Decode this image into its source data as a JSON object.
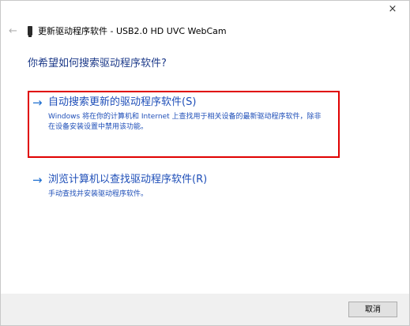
{
  "window": {
    "close_glyph": "×",
    "header": {
      "back_glyph": "←",
      "title": "更新驱动程序软件 - USB2.0 HD UVC WebCam"
    }
  },
  "question": "你希望如何搜索驱动程序软件?",
  "options": [
    {
      "arrow": "→",
      "title": "自动搜索更新的驱动程序软件(S)",
      "description": "Windows 将在你的计算机和 Internet 上查找用于相关设备的最新驱动程序软件，除非在设备安装设置中禁用该功能。"
    },
    {
      "arrow": "→",
      "title": "浏览计算机以查找驱动程序软件(R)",
      "description": "手动查找并安装驱动程序软件。"
    }
  ],
  "footer": {
    "cancel_label": "取消"
  },
  "colors": {
    "link_blue": "#1f4fb8",
    "highlight_red": "#e00000"
  }
}
